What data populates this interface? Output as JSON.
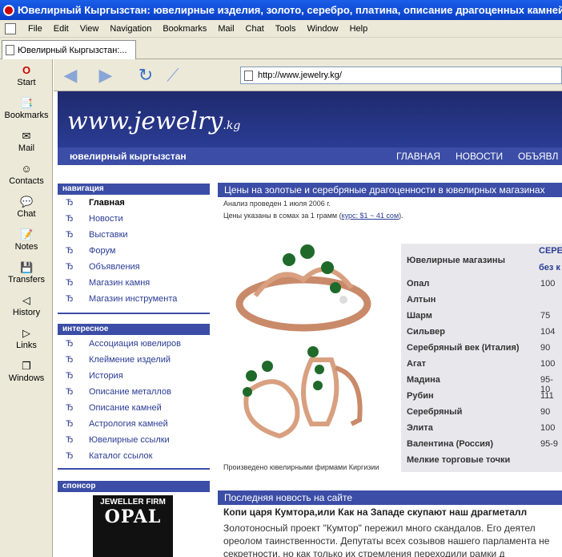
{
  "window": {
    "title": "Ювелирный Кыргызстан: ювелирные изделия, золото, серебро, платина, описание драгоценных камней"
  },
  "menu": [
    "File",
    "Edit",
    "View",
    "Navigation",
    "Bookmarks",
    "Mail",
    "Chat",
    "Tools",
    "Window",
    "Help"
  ],
  "tab": {
    "label": "Ювелирный Кыргызстан:..."
  },
  "sidebar": [
    {
      "label": "Start",
      "icon": "opera-icon"
    },
    {
      "label": "Bookmarks",
      "icon": "bookmarks-icon"
    },
    {
      "label": "Mail",
      "icon": "mail-icon"
    },
    {
      "label": "Contacts",
      "icon": "contacts-icon"
    },
    {
      "label": "Chat",
      "icon": "chat-icon"
    },
    {
      "label": "Notes",
      "icon": "notes-icon"
    },
    {
      "label": "Transfers",
      "icon": "transfers-icon"
    },
    {
      "label": "History",
      "icon": "history-icon"
    },
    {
      "label": "Links",
      "icon": "links-icon"
    },
    {
      "label": "Windows",
      "icon": "windows-icon"
    }
  ],
  "address": {
    "url": "http://www.jewelry.kg/"
  },
  "site": {
    "logo": "www.jewelry",
    "logo_suffix": ".kg",
    "name": "ювелирный кыргызстан",
    "topnav": [
      "ГЛАВНАЯ",
      "НОВОСТИ",
      "ОБЪЯВЛ"
    ]
  },
  "left": {
    "nav_title": "навигация",
    "nav": [
      "Главная",
      "Новости",
      "Выставки",
      "Форум",
      "Объявления",
      "Магазин камня",
      "Магазин инструмента"
    ],
    "int_title": "интересное",
    "interesting": [
      "Ассоциация ювелиров",
      "Клеймение изделий",
      "История",
      "Описание металлов",
      "Описание камней",
      "Астрология камней",
      "Ювелирные ссылки",
      "Каталог ссылок"
    ],
    "sponsor_title": "спонсор",
    "sponsor": {
      "line1": "JEWELLER FIRM",
      "line2": "OPAL"
    }
  },
  "main": {
    "title": "Цены на золотые и серебряные драгоценности в ювелирных магазинах",
    "date": "Анализ проведен 1 июля 2006 г.",
    "note_pre": "Цены указаны в сомах за 1 грамм (",
    "note_link": "курс: $1 ~ 41 сом",
    "note_post": ").",
    "caption": "Произведено ювелирными фирмами Киргизии"
  },
  "prices": {
    "header": "Ювелирные магазины",
    "col1": "СЕРЕ",
    "col2": "без к",
    "rows": [
      {
        "shop": "Опал",
        "v": "100"
      },
      {
        "shop": "Алтын",
        "v": ""
      },
      {
        "shop": "Шарм",
        "v": "75"
      },
      {
        "shop": "Сильвер",
        "v": "104"
      },
      {
        "shop": "Серебряный век (Италия)",
        "v": "90"
      },
      {
        "shop": "Агат",
        "v": "100"
      },
      {
        "shop": "Мадина",
        "v": "95-10"
      },
      {
        "shop": "Рубин",
        "v": "111"
      },
      {
        "shop": "Серебряный",
        "v": "90"
      },
      {
        "shop": "Элита",
        "v": "100"
      },
      {
        "shop": "Валентина (Россия)",
        "v": "95-9"
      },
      {
        "shop": "Мелкие торговые точки",
        "v": ""
      }
    ]
  },
  "news": {
    "section": "Последняя новость на сайте",
    "headline": "Копи царя Кумтора,или Как на Западе скупают наш драгметалл",
    "lines": [
      "Золотоносный проект \"Кумтор\" пережил много скандалов. Его деятел",
      "ореолом таинственности. Депутаты всех созывов нашего парламента не",
      "секретности, но как только их стремления переходили рамки д"
    ]
  },
  "colors": {
    "accent": "#3b4da6",
    "banner": "#1f2a6e"
  }
}
